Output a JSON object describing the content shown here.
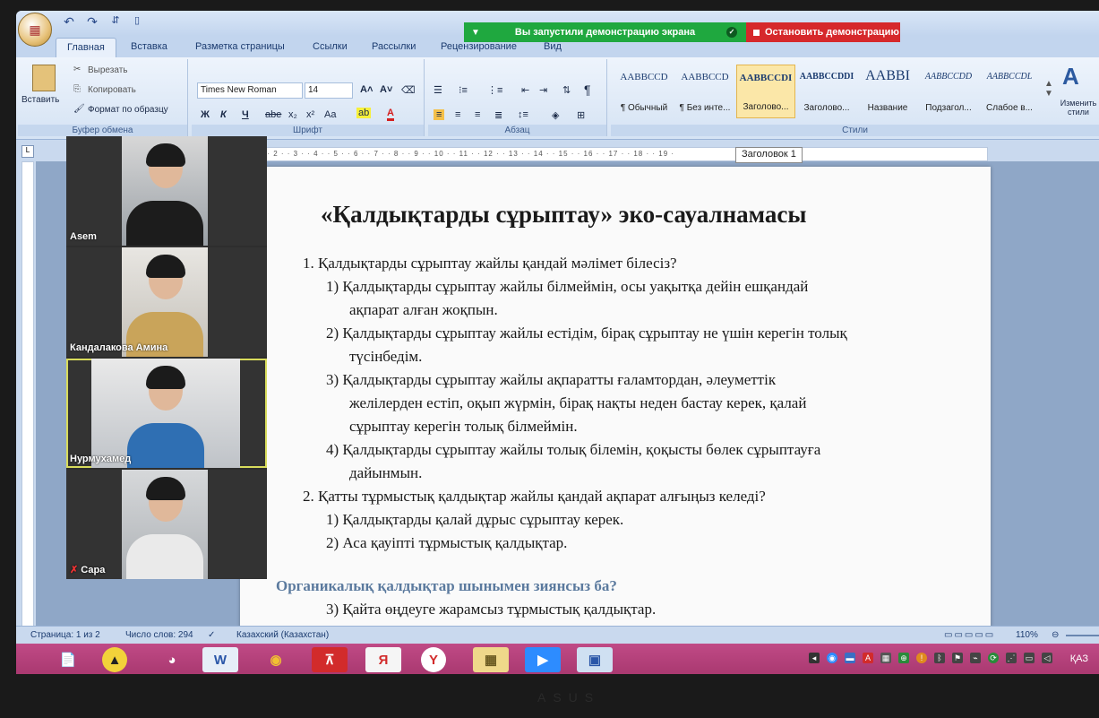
{
  "qat": {
    "undo": "↶",
    "redo": "↷"
  },
  "share": {
    "status": "Вы запустили демонстрацию экрана",
    "stop_label": "Остановить демонстрацию"
  },
  "tabs": [
    "Главная",
    "Вставка",
    "Разметка страницы",
    "Ссылки",
    "Рассылки",
    "Рецензирование",
    "Вид"
  ],
  "clipboard": {
    "paste": "Вставить",
    "cut": "Вырезать",
    "copy": "Копировать",
    "format_painter": "Формат по образцу",
    "label": "Буфер обмена"
  },
  "font": {
    "name": "Times New Roman",
    "size": "14",
    "label": "Шрифт",
    "bold": "Ж",
    "italic": "К",
    "underline": "Ч",
    "strike": "abe",
    "sub": "x₂",
    "sup": "x²",
    "case": "Aa",
    "grow": "A˄",
    "shrink": "A˅",
    "highlight": "ab",
    "color": "A"
  },
  "paragraph": {
    "label": "Абзац"
  },
  "styles": {
    "label": "Стили",
    "items": [
      {
        "sample": "AABBCCD",
        "name": "¶ Обычный"
      },
      {
        "sample": "AABBCCD",
        "name": "¶ Без инте..."
      },
      {
        "sample": "AABBCCDI",
        "name": "Заголово..."
      },
      {
        "sample": "AABBCCDDI",
        "name": "Заголово..."
      },
      {
        "sample": "AABBI",
        "name": "Название"
      },
      {
        "sample": "AABBCCDD",
        "name": "Подзагол..."
      },
      {
        "sample": "AABBCCDL",
        "name": "Слабое в..."
      }
    ],
    "change_label": "Изменить стили"
  },
  "tooltip": "Заголовок 1",
  "ruler": "· · 1 · · 2 · · 3 · · 4 · · 5 · · 6 · · 7 · · 8 · · 9 · · 10 · · 11 · · 12 · · 13 · · 14 · · 15 · · 16 · · 17 · · 18 · · 19 ·",
  "participants": [
    {
      "name": "Asem"
    },
    {
      "name": "Кандалакова Амина"
    },
    {
      "name": "Нурмухамед"
    },
    {
      "name": "Сара"
    }
  ],
  "document": {
    "title": "«Қалдықтарды сұрыптау» эко-сауалнамасы",
    "lines": [
      "1.  Қалдықтарды сұрыптау жайлы қандай мәлімет білесіз?",
      "1)  Қалдықтарды сұрыптау жайлы білмеймін, осы уақытқа дейін ешқандай",
      "ақпарат алған жоқпын.",
      "2)  Қалдықтарды сұрыптау жайлы естідім, бірақ сұрыптау не үшін керегін толық",
      "түсінбедім.",
      "3)  Қалдықтарды сұрыптау жайлы ақпаратты ғаламтордан, әлеуметтік",
      "желілерден естіп, оқып жүрмін, бірақ нақты неден бастау керек, қалай",
      "сұрыптау керегін толық білмеймін.",
      "4)  Қалдықтарды сұрыптау жайлы толық білемін, қоқысты бөлек сұрыптауға",
      "дайынмын.",
      "2.  Қатты тұрмыстық қалдықтар жайлы қандай ақпарат алғыңыз келеді?",
      "1)  Қалдықтарды қалай дұрыс сұрыптау керек.",
      "2)  Аса қауіпті тұрмыстық қалдықтар."
    ],
    "heading2": "Органикалық қалдықтар шынымен зиянсыз ба?",
    "after_heading": "3)  Қайта өңдеуге жарамсыз тұрмыстық қалдықтар."
  },
  "status": {
    "page": "Страница: 1 из 2",
    "words": "Число слов: 294",
    "language": "Казахский (Казахстан)",
    "zoom": "110%"
  },
  "taskbar": {
    "lang": "ҚАЗ",
    "apps": [
      "📄",
      "▲",
      "◕",
      "W",
      "◉",
      "⊼",
      "Я",
      "Y",
      "▦",
      "▶",
      "▣"
    ]
  }
}
